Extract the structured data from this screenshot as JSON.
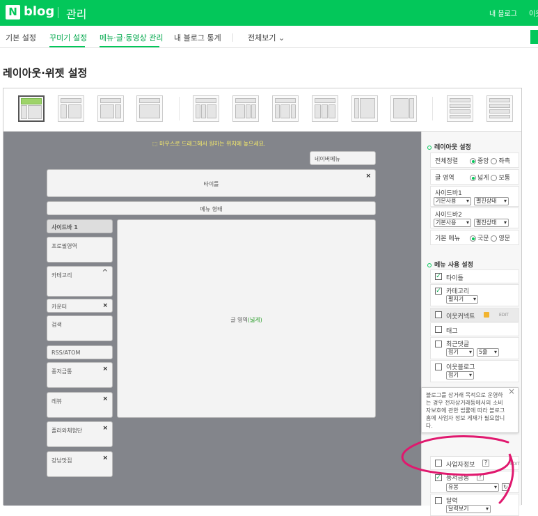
{
  "topbar": {
    "logo_n": "N",
    "logo_blog": "blog",
    "manage": "관리",
    "my_blog": "내 블로그",
    "neighbor": "이웃"
  },
  "subnav": {
    "items": [
      "기본 설정",
      "꾸미기 설정",
      "메뉴·글·동영상 관리",
      "내 블로그 통계",
      "전체보기"
    ]
  },
  "page_title": "레이아웃·위젯 설정",
  "canvas": {
    "hint": "마우스로 드래그해서 원하는 위치에 놓으세요.",
    "neighbor_menu": "네이버메뉴",
    "title": "타이틀",
    "menu_type": "메뉴 형태",
    "sidebar_head": "사이드바 1",
    "widgets": [
      "프로필영역",
      "카테고리",
      "카운터",
      "검색",
      "RSS/ATOM",
      "풍저금통",
      "레뷰",
      "플러와체험단",
      "강남맛집"
    ],
    "post_area": "글 영역",
    "post_area_paren": "(넓게)",
    "close": "×",
    "caret": "^"
  },
  "layout_settings": {
    "title": "레이아웃 설정",
    "align_label": "전체정렬",
    "align_opts": [
      "중앙",
      "좌측"
    ],
    "post_label": "글 영역",
    "post_opts": [
      "넓게",
      "보통"
    ],
    "sidebar1": "사이드바1",
    "sidebar2": "사이드바2",
    "sb_use": "기본사용",
    "sb_state": "펼친상태",
    "basic_menu": "기본 메뉴",
    "menu_opts": [
      "국문",
      "영문"
    ]
  },
  "menu_settings": {
    "title": "메뉴 사용 설정",
    "items": [
      "타이틀",
      "카테고리",
      "이웃커넥트",
      "태그",
      "최근댓글",
      "이웃블로그",
      "사업자정보",
      "풍저금통",
      "달력"
    ],
    "category_sel": "펼치기",
    "recent_sel1": "접기",
    "recent_sel2": "5줄",
    "neighbor_sel": "접기",
    "bank_sel": "유봉",
    "calendar_sel": "달력보기",
    "edit": "EDIT",
    "q": "?"
  },
  "tooltip": {
    "text": "블로그를 상거래 목적으로 운영하는 경우 전자상거래등에서의 소비자보호에 관한 법률에 따라 블로그홈에 사업자 정보 게재가 필요합니다.",
    "close": "×"
  },
  "colors": {
    "brand": "#03c75a",
    "canvas": "#83858b",
    "annotation": "#e0186e"
  }
}
